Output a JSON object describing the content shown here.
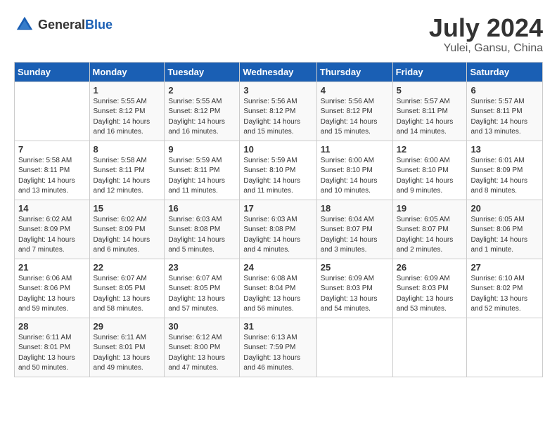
{
  "header": {
    "logo_general": "General",
    "logo_blue": "Blue",
    "month_year": "July 2024",
    "location": "Yulei, Gansu, China"
  },
  "weekdays": [
    "Sunday",
    "Monday",
    "Tuesday",
    "Wednesday",
    "Thursday",
    "Friday",
    "Saturday"
  ],
  "weeks": [
    [
      {
        "num": "",
        "info": ""
      },
      {
        "num": "1",
        "info": "Sunrise: 5:55 AM\nSunset: 8:12 PM\nDaylight: 14 hours\nand 16 minutes."
      },
      {
        "num": "2",
        "info": "Sunrise: 5:55 AM\nSunset: 8:12 PM\nDaylight: 14 hours\nand 16 minutes."
      },
      {
        "num": "3",
        "info": "Sunrise: 5:56 AM\nSunset: 8:12 PM\nDaylight: 14 hours\nand 15 minutes."
      },
      {
        "num": "4",
        "info": "Sunrise: 5:56 AM\nSunset: 8:12 PM\nDaylight: 14 hours\nand 15 minutes."
      },
      {
        "num": "5",
        "info": "Sunrise: 5:57 AM\nSunset: 8:11 PM\nDaylight: 14 hours\nand 14 minutes."
      },
      {
        "num": "6",
        "info": "Sunrise: 5:57 AM\nSunset: 8:11 PM\nDaylight: 14 hours\nand 13 minutes."
      }
    ],
    [
      {
        "num": "7",
        "info": "Sunrise: 5:58 AM\nSunset: 8:11 PM\nDaylight: 14 hours\nand 13 minutes."
      },
      {
        "num": "8",
        "info": "Sunrise: 5:58 AM\nSunset: 8:11 PM\nDaylight: 14 hours\nand 12 minutes."
      },
      {
        "num": "9",
        "info": "Sunrise: 5:59 AM\nSunset: 8:11 PM\nDaylight: 14 hours\nand 11 minutes."
      },
      {
        "num": "10",
        "info": "Sunrise: 5:59 AM\nSunset: 8:10 PM\nDaylight: 14 hours\nand 11 minutes."
      },
      {
        "num": "11",
        "info": "Sunrise: 6:00 AM\nSunset: 8:10 PM\nDaylight: 14 hours\nand 10 minutes."
      },
      {
        "num": "12",
        "info": "Sunrise: 6:00 AM\nSunset: 8:10 PM\nDaylight: 14 hours\nand 9 minutes."
      },
      {
        "num": "13",
        "info": "Sunrise: 6:01 AM\nSunset: 8:09 PM\nDaylight: 14 hours\nand 8 minutes."
      }
    ],
    [
      {
        "num": "14",
        "info": "Sunrise: 6:02 AM\nSunset: 8:09 PM\nDaylight: 14 hours\nand 7 minutes."
      },
      {
        "num": "15",
        "info": "Sunrise: 6:02 AM\nSunset: 8:09 PM\nDaylight: 14 hours\nand 6 minutes."
      },
      {
        "num": "16",
        "info": "Sunrise: 6:03 AM\nSunset: 8:08 PM\nDaylight: 14 hours\nand 5 minutes."
      },
      {
        "num": "17",
        "info": "Sunrise: 6:03 AM\nSunset: 8:08 PM\nDaylight: 14 hours\nand 4 minutes."
      },
      {
        "num": "18",
        "info": "Sunrise: 6:04 AM\nSunset: 8:07 PM\nDaylight: 14 hours\nand 3 minutes."
      },
      {
        "num": "19",
        "info": "Sunrise: 6:05 AM\nSunset: 8:07 PM\nDaylight: 14 hours\nand 2 minutes."
      },
      {
        "num": "20",
        "info": "Sunrise: 6:05 AM\nSunset: 8:06 PM\nDaylight: 14 hours\nand 1 minute."
      }
    ],
    [
      {
        "num": "21",
        "info": "Sunrise: 6:06 AM\nSunset: 8:06 PM\nDaylight: 13 hours\nand 59 minutes."
      },
      {
        "num": "22",
        "info": "Sunrise: 6:07 AM\nSunset: 8:05 PM\nDaylight: 13 hours\nand 58 minutes."
      },
      {
        "num": "23",
        "info": "Sunrise: 6:07 AM\nSunset: 8:05 PM\nDaylight: 13 hours\nand 57 minutes."
      },
      {
        "num": "24",
        "info": "Sunrise: 6:08 AM\nSunset: 8:04 PM\nDaylight: 13 hours\nand 56 minutes."
      },
      {
        "num": "25",
        "info": "Sunrise: 6:09 AM\nSunset: 8:03 PM\nDaylight: 13 hours\nand 54 minutes."
      },
      {
        "num": "26",
        "info": "Sunrise: 6:09 AM\nSunset: 8:03 PM\nDaylight: 13 hours\nand 53 minutes."
      },
      {
        "num": "27",
        "info": "Sunrise: 6:10 AM\nSunset: 8:02 PM\nDaylight: 13 hours\nand 52 minutes."
      }
    ],
    [
      {
        "num": "28",
        "info": "Sunrise: 6:11 AM\nSunset: 8:01 PM\nDaylight: 13 hours\nand 50 minutes."
      },
      {
        "num": "29",
        "info": "Sunrise: 6:11 AM\nSunset: 8:01 PM\nDaylight: 13 hours\nand 49 minutes."
      },
      {
        "num": "30",
        "info": "Sunrise: 6:12 AM\nSunset: 8:00 PM\nDaylight: 13 hours\nand 47 minutes."
      },
      {
        "num": "31",
        "info": "Sunrise: 6:13 AM\nSunset: 7:59 PM\nDaylight: 13 hours\nand 46 minutes."
      },
      {
        "num": "",
        "info": ""
      },
      {
        "num": "",
        "info": ""
      },
      {
        "num": "",
        "info": ""
      }
    ]
  ]
}
